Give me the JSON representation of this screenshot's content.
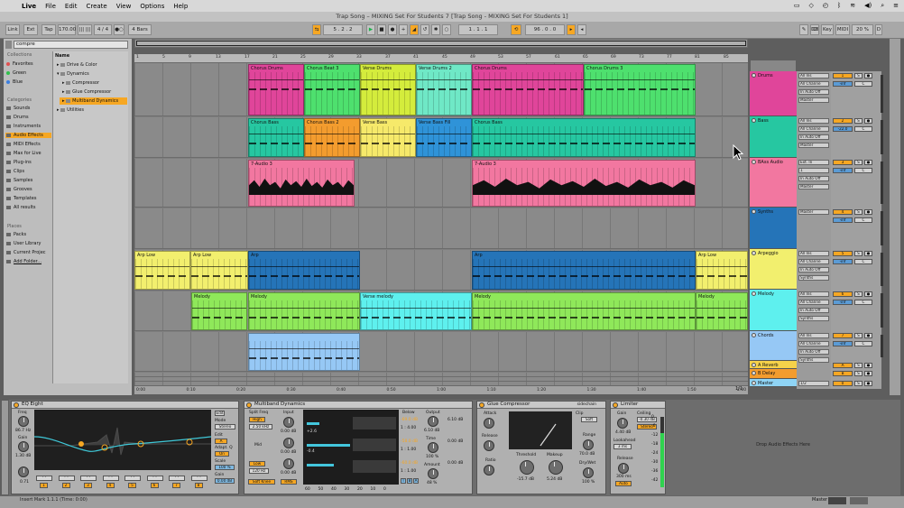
{
  "menubar": {
    "apple": "",
    "app": "Live",
    "items": [
      "File",
      "Edit",
      "Create",
      "View",
      "Options",
      "Help"
    ]
  },
  "window_title": "Trap Song – MIXING Set For Students 7  [Trap Song - MIXING Set For Students 1]",
  "transport": {
    "link": "Link",
    "ext": "Ext",
    "tap": "Tap",
    "tempo": "170.00",
    "nudge": "||| |||",
    "sig": "4 / 4",
    "metro": "●○",
    "quant": "4 Bars",
    "pos": "5 .  2 .  2",
    "loop_start": "1 .  1 .  1",
    "loop_len": "96 .  0 .  0",
    "key": "Key",
    "midi": "MIDI",
    "cpu": "20 %",
    "d": "D"
  },
  "browser": {
    "search": "compre",
    "collections_label": "Collections",
    "collections": [
      {
        "name": "Favorites",
        "color": "#e05050"
      },
      {
        "name": "Green",
        "color": "#2fbf4a"
      },
      {
        "name": "Blue",
        "color": "#3a7ee0"
      }
    ],
    "categories_label": "Categories",
    "categories": [
      "Sounds",
      "Drums",
      "Instruments",
      "Audio Effects",
      "MIDI Effects",
      "Max for Live",
      "Plug-ins",
      "Clips",
      "Samples",
      "Grooves",
      "Templates",
      "All results"
    ],
    "places_label": "Places",
    "places": [
      "Packs",
      "User Library",
      "Current Projec",
      "Add Folder..."
    ],
    "name_col": "Name",
    "tree": [
      "Drive & Color",
      "Dynamics",
      "Compressor",
      "Glue Compressor",
      "Multiband Dynamics",
      "Utilities"
    ]
  },
  "ruler": [
    "1",
    "5",
    "9",
    "13",
    "17",
    "21",
    "25",
    "29",
    "33",
    "37",
    "41",
    "45",
    "49",
    "53",
    "57",
    "61",
    "65",
    "69",
    "73",
    "77",
    "81",
    "85",
    "89",
    "93"
  ],
  "timeline": [
    "0:00",
    "0:10",
    "0:20",
    "0:30",
    "0:40",
    "0:50",
    "1:00",
    "1:10",
    "1:20",
    "1:30",
    "1:40",
    "1:50",
    "2:00"
  ],
  "zoom_text": "1/1",
  "clips": [
    {
      "lane": 0,
      "name": "Chorus Drums",
      "color": "#e0459a"
    },
    {
      "lane": 0,
      "name": "Chorus Beat 3",
      "color": "#4ee06e"
    },
    {
      "lane": 0,
      "name": "Verse Drums",
      "color": "#d4ec3c"
    },
    {
      "lane": 0,
      "name": "Verse Drums 2",
      "color": "#6fe8c6"
    },
    {
      "lane": 0,
      "name": "Chorus Drums",
      "color": "#e0459a"
    },
    {
      "lane": 0,
      "name": "Chorus Drums 3",
      "color": "#4ee06e"
    },
    {
      "lane": 1,
      "name": "Chorus Bass",
      "color": "#26c7a1"
    },
    {
      "lane": 1,
      "name": "Chorus Bass 2",
      "color": "#f39c2e"
    },
    {
      "lane": 1,
      "name": "Verse Bass",
      "color": "#f6e96a"
    },
    {
      "lane": 1,
      "name": "Verse Bass Fill",
      "color": "#2f93d8"
    },
    {
      "lane": 1,
      "name": "Chorus Bass",
      "color": "#26c7a1"
    },
    {
      "lane": 2,
      "name": "7-Audio 3",
      "color": "#f277a0"
    },
    {
      "lane": 2,
      "name": "7-Audio 3",
      "color": "#f277a0"
    },
    {
      "lane": 4,
      "name": "Arp Low",
      "color": "#f2ef6e"
    },
    {
      "lane": 4,
      "name": "Arp Low",
      "color": "#f2ef6e"
    },
    {
      "lane": 4,
      "name": "Arp",
      "color": "#2574b8"
    },
    {
      "lane": 4,
      "name": "Arp",
      "color": "#2574b8"
    },
    {
      "lane": 4,
      "name": "Arp Low",
      "color": "#f2ef6e"
    },
    {
      "lane": 5,
      "name": "Melody",
      "color": "#8fe85a"
    },
    {
      "lane": 5,
      "name": "Melody",
      "color": "#8fe85a"
    },
    {
      "lane": 5,
      "name": "Verse melody",
      "color": "#5ef0ee"
    },
    {
      "lane": 5,
      "name": "Melody",
      "color": "#8fe85a"
    },
    {
      "lane": 5,
      "name": "Melody",
      "color": "#8fe85a"
    },
    {
      "lane": 6,
      "name": "",
      "color": "#96c8f5"
    }
  ],
  "tracks": [
    {
      "name": "Drums",
      "color": "#e0459a",
      "io": [
        "All Ins",
        "All Channe",
        "In Auto Off",
        "Master"
      ],
      "num": "1",
      "vol": "-inf",
      "pan": "C"
    },
    {
      "name": "Bass",
      "color": "#26c7a1",
      "io": [
        "All Ins",
        "All Channe",
        "In Auto Off",
        "Master"
      ],
      "num": "2",
      "vol": "-22.0",
      "pan": "C"
    },
    {
      "name": "BAss Audio",
      "color": "#f277a0",
      "io": [
        "Ext. In",
        "1",
        "In Auto Off",
        "Master"
      ],
      "num": "3",
      "vol": "-inf",
      "pan": "C"
    },
    {
      "name": "Synths",
      "color": "#2574b8",
      "io": [
        "Master"
      ],
      "num": "4",
      "vol": "-inf",
      "pan": "C"
    },
    {
      "name": "Arpeggio",
      "color": "#f2ef6e",
      "io": [
        "All Ins",
        "All Channe",
        "In Auto Off",
        "Synths"
      ],
      "num": "5",
      "vol": "-inf",
      "pan": "C"
    },
    {
      "name": "Melody",
      "color": "#5ef0ee",
      "io": [
        "All Ins",
        "All Channe",
        "In Auto Off",
        "Synths"
      ],
      "num": "6",
      "vol": "-inf",
      "pan": "C"
    },
    {
      "name": "Chords",
      "color": "#96c8f5",
      "io": [
        "All Ins",
        "All Channe",
        "In Auto Off",
        "Synths"
      ],
      "num": "7",
      "vol": "-inf",
      "pan": "C"
    },
    {
      "name": "A Reverb",
      "color": "#f6d24a",
      "io": [],
      "num": "A",
      "vol": "-inf",
      "pan": "C"
    },
    {
      "name": "B Delay",
      "color": "#f39c2e",
      "io": [],
      "num": "B",
      "vol": "-inf",
      "pan": "C"
    },
    {
      "name": "Master",
      "color": "#8fd4f5",
      "io": [
        "1/2"
      ],
      "num": "0",
      "vol": "0",
      "pan": "C"
    }
  ],
  "eq": {
    "title": "EQ Eight",
    "freq_label": "Freq",
    "freq": "86.7 Hz",
    "gain_label": "Gain",
    "gain": "1.30 dB",
    "q": "0.71",
    "mode_label": "Mode",
    "mode": "Stereo",
    "edit": "Edit",
    "adapt": "Adapt. Q",
    "on": "On",
    "scale_label": "Scale",
    "scale": "100 %",
    "gain2_label": "Gain",
    "gain2": "0.00 dB",
    "bands": [
      "1",
      "2",
      "3",
      "4",
      "5",
      "6",
      "7",
      "8"
    ]
  },
  "mb": {
    "title": "Multiband Dynamics",
    "split_label": "Split Freq",
    "input_label": "Input",
    "high": "High",
    "high_freq": "2.50 kHz",
    "mid": "Mid",
    "low": "Low",
    "low_freq": "120 Hz",
    "input_vals": [
      "0.00 dB",
      "0.00 dB",
      "0.00 dB"
    ],
    "soft_knee": "Soft Knee",
    "rms": "RMS",
    "below_label": "Below",
    "below": [
      "-69.0 dB",
      "-58.0 dB",
      "-60.0 dB"
    ],
    "ratio": [
      "1 : 4.00",
      "1 : 1.00",
      "1 : 1.00"
    ],
    "output_label": "Output",
    "output": [
      "6.10 dB",
      "0.00 dB",
      "0.00 dB"
    ],
    "time_label": "Time",
    "time": "100 %",
    "amount_label": "Amount",
    "amount": "48 %",
    "graph_vals": [
      "+2.6",
      "-0.4"
    ],
    "scale": [
      "60",
      "50",
      "40",
      "30",
      "20",
      "10",
      "0"
    ]
  },
  "glue": {
    "title": "Glue Compressor",
    "sidechain": "sidechain",
    "attack_label": "Attack",
    "release_label": "Release",
    "ratio_label": "Ratio",
    "clip_label": "Clip",
    "soft": "Soft",
    "threshold_label": "Threshold",
    "threshold": "-15.7 dB",
    "makeup_label": "Makeup",
    "makeup": "5.24 dB",
    "range_label": "Range",
    "range": "70.0 dB",
    "drywet_label": "Dry/Wet",
    "drywet": "100 %"
  },
  "limiter": {
    "title": "Limiter",
    "gain_label": "Gain",
    "gain": "4.40 dB",
    "ceiling_label": "Ceiling",
    "ceiling": "-0.30 dB",
    "stereo": "Stereo",
    "lookahead_label": "Lookahead",
    "lookahead": "3 ms",
    "release_label": "Release",
    "release": "300 ms",
    "auto": "Auto",
    "scale": [
      "0",
      "-6",
      "-12",
      "-18",
      "-24",
      "-30",
      "-36",
      "-42"
    ]
  },
  "drop_hint": "Drop Audio Effects Here",
  "status": "Insert Mark 1.1.1 (Time: 0:00)",
  "master_label": "Master"
}
